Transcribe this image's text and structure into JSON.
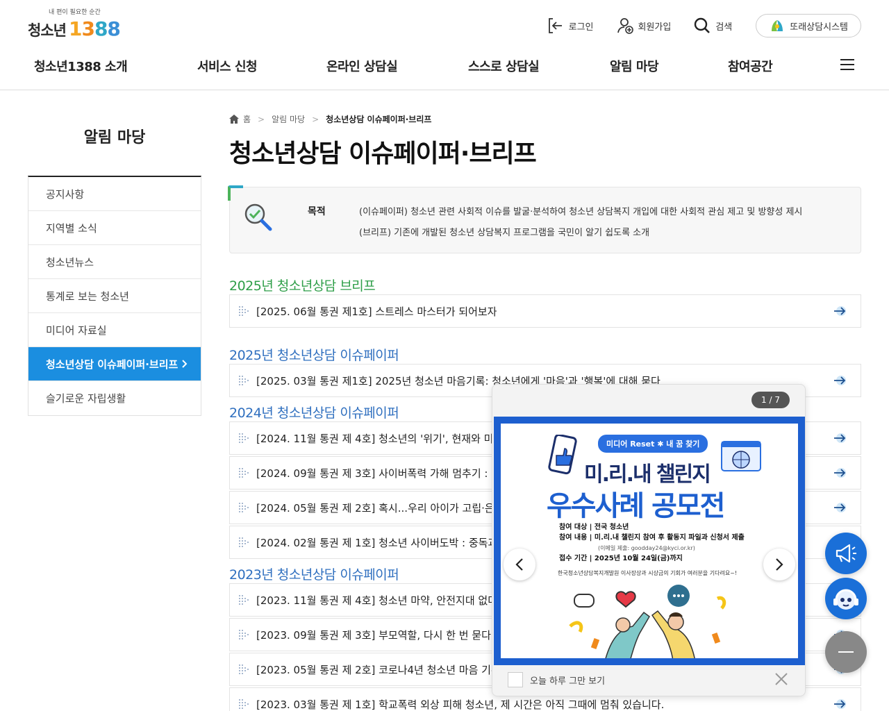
{
  "header": {
    "logo_tagline": "내 편이 필요한 순간",
    "logo_text": "청소년",
    "logo_num": [
      "1",
      "3",
      "8",
      "8"
    ],
    "login": "로그인",
    "signup": "회원가입",
    "search": "검색",
    "peer_system": "또래상담시스템"
  },
  "gnb": [
    "청소년1388 소개",
    "서비스 신청",
    "온라인 상담실",
    "스스로 상담실",
    "알림 마당",
    "참여공간"
  ],
  "sidebar": {
    "title": "알림 마당",
    "items": [
      {
        "label": "공지사항"
      },
      {
        "label": "지역별 소식"
      },
      {
        "label": "청소년뉴스"
      },
      {
        "label": "통계로 보는 청소년"
      },
      {
        "label": "미디어 자료실"
      },
      {
        "label": "청소년상담 이슈페이퍼·브리프",
        "active": true
      },
      {
        "label": "슬기로운 자립생활"
      }
    ]
  },
  "breadcrumb": {
    "home": "홈",
    "parent": "알림 마당",
    "current": "청소년상담 이슈페이퍼·브리프"
  },
  "page_title": "청소년상담 이슈페이퍼·브리프",
  "purpose": {
    "label": "목적",
    "line1": "(이슈페이퍼) 청소년 관련 사회적 이슈를 발굴·분석하여 청소년 상담복지 개입에 대한 사회적 관심 제고 및 방향성 제시",
    "line2": "(브리프) 기존에 개발된 청소년 상담복지 프로그램을 국민이 알기 쉽도록 소개"
  },
  "sections": [
    {
      "title": "2025년 청소년상담 브리프",
      "color": "#2e9e48",
      "items": [
        "[2025. 06월 통권 제1호] 스트레스 마스터가 되어보자"
      ]
    },
    {
      "title": "2025년 청소년상담 이슈페이퍼",
      "color": "#2f6fbf",
      "items": [
        "[2025. 03월 통권 제1호] 2025년 청소년 마음기록: 청소년에게 '마음'과 '행복'에 대해 묻다"
      ]
    },
    {
      "title": "2024년 청소년상담 이슈페이퍼",
      "color": "#2f6fbf",
      "items": [
        "[2024. 11월 통권 제 4호] 청소년의 '위기', 현재와 미래를",
        "[2024. 09월 통권 제 3호] 사이버폭력 가해 멈추기 : 현",
        "[2024. 05월 통권 제 2호] 혹시...우리 아이가 고립·은둔",
        "[2024. 02월 통권 제 1호] 청소년 사이버도박 : 중독과"
      ]
    },
    {
      "title": "2023년 청소년상담 이슈페이퍼",
      "color": "#2f6fbf",
      "items": [
        "[2023. 11월 통권 제 4호] 청소년 마약, 안전지대 없다",
        "[2023. 09월 통권 제 3호] 부모역할, 다시 한 번 묻다",
        "[2023. 05월 통권 제 2호] 코로나4년 청소년 마음 기록",
        "[2023. 03월 통권 제 1호] 학교폭력 외상 피해 청소년, 제 시간은 아직 그때에 멈춰 있습니다."
      ]
    }
  ],
  "popup": {
    "counter": "1 / 7",
    "tag": "미디어 Reset ✱ 내 꿈 찾기",
    "title1": "미.리.내 챌린지",
    "title2": "우수사례 공모전",
    "target": "참여 대상 | 전국 청소년",
    "content": "참여 내용 | 미.리.내 챌린지 참여 후 활동지 파일과 신청서 제출",
    "email": "(이메일 제출: goodday24@kyci.or.kr)",
    "period": "접수 기간 | 2025년 10월 24일(금)까지",
    "footnote": "한국청소년상담복지개발원 이사장상과 시상금의 기회가 여러분을 기다려요~!",
    "dont_show": "오늘 하루 그만 보기"
  }
}
